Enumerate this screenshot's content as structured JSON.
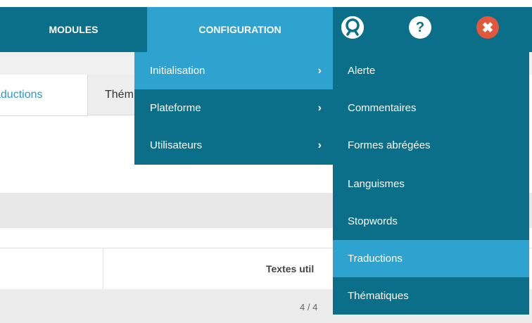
{
  "nav": {
    "modules": "MODULES",
    "configuration": "CONFIGURATION",
    "icons": [
      "support-icon",
      "help-icon",
      "close-icon"
    ]
  },
  "page": {
    "tabs": [
      "aductions",
      "Thém"
    ],
    "table": {
      "header_textes": "Textes util",
      "pager": "4 / 4"
    }
  },
  "submenu": {
    "items": [
      {
        "label": "Initialisation",
        "chevron": "›"
      },
      {
        "label": "Plateforme",
        "chevron": "›"
      },
      {
        "label": "Utilisateurs",
        "chevron": "›"
      }
    ]
  },
  "initialisation_menu": {
    "items": [
      {
        "label": "Alerte"
      },
      {
        "label": "Commentaires"
      },
      {
        "label": "Formes abrégées"
      },
      {
        "label": "Languismes"
      },
      {
        "label": "Stopwords"
      },
      {
        "label": "Traductions"
      },
      {
        "label": "Thématiques"
      }
    ]
  },
  "colors": {
    "dark_teal": "#0b6f8a",
    "light_blue": "#2fa3cf",
    "close_red": "#e2583f"
  }
}
